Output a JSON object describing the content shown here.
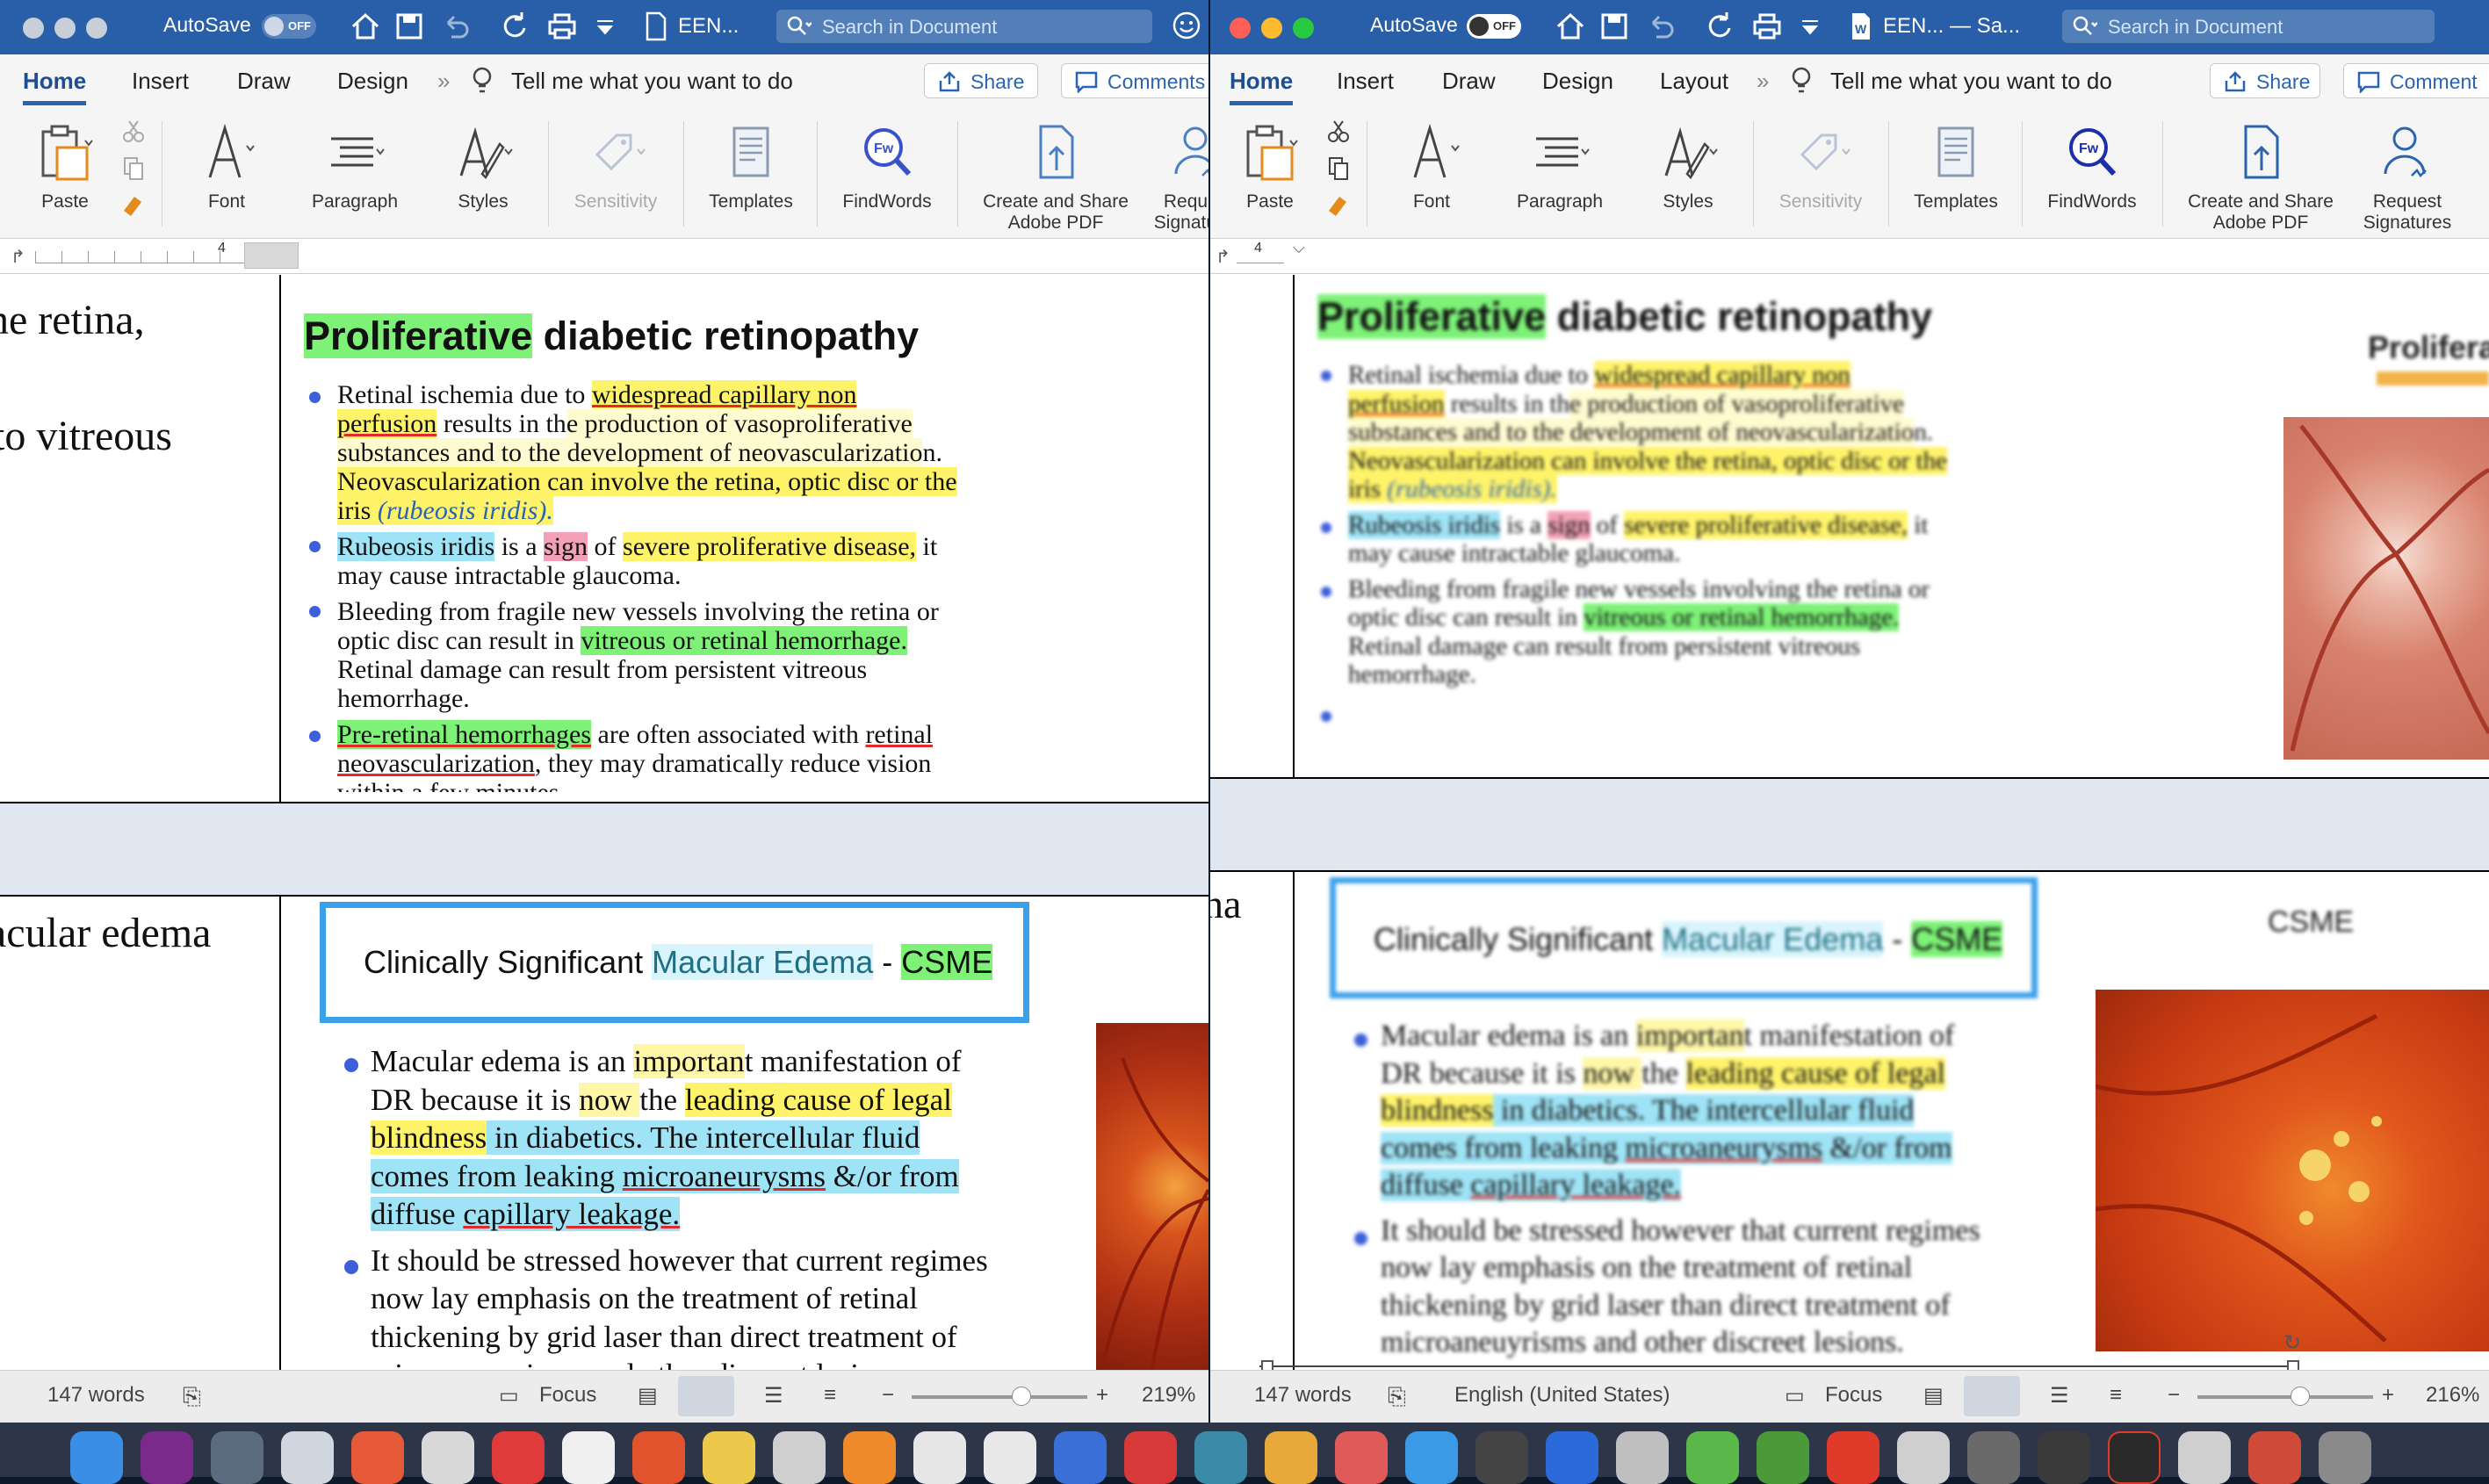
{
  "left": {
    "autosave": "AutoSave",
    "toggle": "OFF",
    "doc_title": "EEN...",
    "search_placeholder": "Search in Document",
    "tabs": [
      "Home",
      "Insert",
      "Draw",
      "Design",
      "Tell me what you want to do"
    ],
    "share": "Share",
    "comments": "Comments",
    "ribbon": [
      "Paste",
      "Font",
      "Paragraph",
      "Styles",
      "Sensitivity",
      "Templates",
      "FindWords",
      "Create and Share",
      "Adobe PDF",
      "Request",
      "Signatures"
    ],
    "ruler_num": "4",
    "left_col": [
      "he retina,",
      "to vitreous",
      "acular edema"
    ],
    "pdr_title": {
      "a": "Proliferative",
      "b": " diabetic retinopathy"
    },
    "pdr": {
      "l1a": "Retinal ischemia due to ",
      "l1b": "widespread capillary non",
      "l2a": "perfusion",
      "l2b": " results in th",
      "l2c": "e production of vasoproliferative",
      "l3": "substances and to the development of neovascularizatio",
      "l3b": "n.",
      "l4": "Neovascularization can involve the retina, optic disc or the",
      "l5a": "iris ",
      "l5b": "(rubeosis iridis).",
      "b2a": "Rubeosis iridis",
      "b2b": " is a ",
      "b2c": "sign",
      "b2d": " of ",
      "b2e": "severe proliferative disease,",
      "b2f": " it",
      "b2g": "may cause intractable glaucoma.",
      "b3a": "Bleeding from fragile new vessels involving the retina or",
      "b3b": "optic disc can result in ",
      "b3c": "vitreous or retinal hemorrhage.",
      "b3d": "Retinal damage can result from persistent vitreous",
      "b3e": "hemorrhage.",
      "b4a": "Pre-retinal hemorrhages",
      "b4b": " are often associated with ",
      "b4c": "retinal",
      "b4d": "neovascularization",
      "b4e": ",  they may dramatically reduce vision",
      "b4f": "within a few minutes."
    },
    "csme": {
      "a": "Clinically Significant ",
      "b": "Macular Edema",
      "c": " - ",
      "d": "CSME"
    },
    "me": {
      "a1": "Macular edema is an ",
      "a2": "importan",
      "a3": "t manifestation of",
      "b1": "DR because it is ",
      "b2": "now ",
      "b3": "the ",
      "b4": "leading cause of legal",
      "c1": "blindness",
      "c2": " in diabetics.",
      "c3": " The intercellular fluid",
      "d1": "comes from leaking ",
      "d2": "microaneurysms",
      "d3": " &/or from",
      "e1": "diffuse ",
      "e2": "capillary leakage.",
      "f1": "It should be stressed however that current regimes",
      "f2": "now lay emphasis on the treatment of retinal",
      "f3": "thickening by grid laser than direct treatment of",
      "f4": "microaneuyrisms and other discreet lesions."
    },
    "status": {
      "words": "147 words",
      "focus": "Focus",
      "zoom": "219%"
    }
  },
  "right": {
    "autosave": "AutoSave",
    "toggle": "OFF",
    "doc_title": "EEN... — Sa...",
    "search_placeholder": "Search in Document",
    "tabs": [
      "Home",
      "Insert",
      "Draw",
      "Design",
      "Layout",
      "Tell me what you want to do"
    ],
    "share": "Share",
    "comments": "Comment",
    "ribbon": [
      "Paste",
      "Font",
      "Paragraph",
      "Styles",
      "Sensitivity",
      "Templates",
      "FindWords",
      "Create and Share",
      "Adobe PDF",
      "Request",
      "Signatures"
    ],
    "ruler_num": "4",
    "left_col": [
      "na"
    ],
    "side_title": "Prolifera",
    "side_csme": "CSME",
    "status": {
      "words": "147 words",
      "language": "English (United States)",
      "focus": "Focus",
      "zoom": "216%"
    }
  },
  "colors": {
    "titlebar": "#285fa8",
    "accent": "#2a64b0",
    "yellow": "#fff36a",
    "green": "#7df277",
    "blue": "#9ee3f6",
    "pink": "#f3a1b7",
    "csme_border": "#3aa0ea"
  }
}
